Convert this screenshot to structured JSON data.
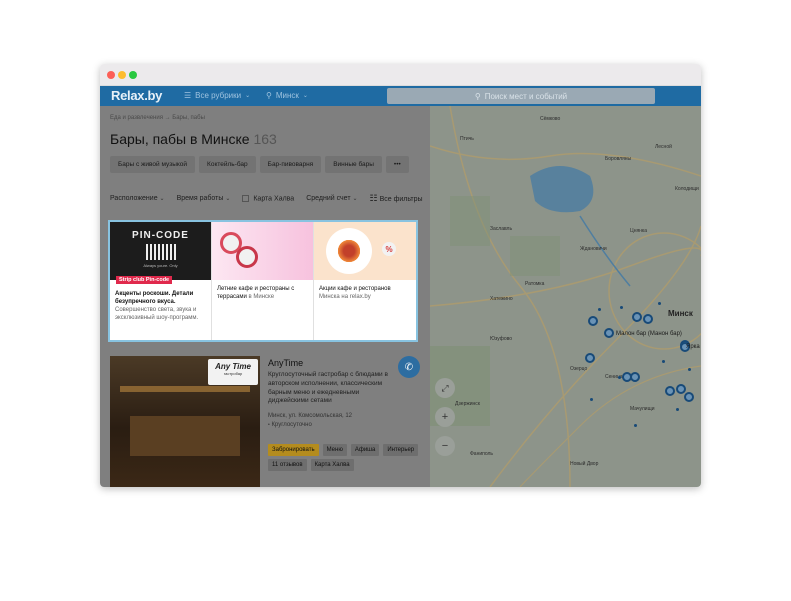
{
  "window": {
    "controls": [
      "close",
      "minimize",
      "maximize"
    ]
  },
  "header": {
    "logo": "Relax.by",
    "rubrics": "Все рубрики",
    "city": "Минск",
    "search_placeholder": "Поиск мест и событий",
    "colors": {
      "header_bg": "#1f6ba3"
    }
  },
  "page": {
    "breadcrumb": "Еда и развлечения → Бары, пабы",
    "title": "Бары, пабы в Минске",
    "count": "163",
    "tags": [
      "Бары с живой музыкой",
      "Коктейль-бар",
      "Бар-пивоварня",
      "Винные бары",
      "•••"
    ],
    "filters": {
      "location": "Расположение",
      "hours": "Время работы",
      "halva": "Карта Халва",
      "avg_check": "Средний счет",
      "all_filters": "Все фильтры"
    }
  },
  "promos": [
    {
      "image_title": "PIN-CODE",
      "image_caption": "Always youre. Only",
      "badge": "Strip club Pin-code",
      "title": "Акценты роскоши. Детали безупречного вкуса.",
      "text": "Совершенство света, звука и эксклюзивный шоу-программ."
    },
    {
      "title": "Летние кафе и рестораны с террасами",
      "text": "в Минске"
    },
    {
      "title": "Акции кафе и ресторанов",
      "text": "Минска на relax.by"
    }
  ],
  "venue": {
    "name": "AnyTime",
    "logo_text": "Any Time",
    "logo_sub": "гастробар",
    "description": "Круглосуточный гастробар с блюдами в авторском исполнении, классическим барным меню и ежедневными диджейскими сетами",
    "address": "Минск, ул. Комсомольская, 12",
    "hours": "Круглосуточно",
    "buttons": [
      "Забронировать",
      "Меню",
      "Афиша",
      "Интерьер"
    ],
    "buttons2": [
      "11 отзывов",
      "Карта Халва"
    ]
  },
  "map": {
    "labels": [
      "Сёмково",
      "Птичь",
      "Боровляны",
      "Цнянка",
      "Заславль",
      "Ждановичи",
      "Лесной",
      "Колодищи",
      "Минск",
      "Хатежино",
      "Ратомка",
      "Юзуфово",
      "Дзержинск",
      "Мачулищи",
      "Сеница",
      "Фаниполь",
      "Озерцо",
      "Новый Двор"
    ],
    "pin_labels": [
      "Малон бар (Манон бар)",
      "Ярка"
    ],
    "controls": [
      "fullscreen",
      "zoom-in",
      "zoom-out"
    ]
  }
}
